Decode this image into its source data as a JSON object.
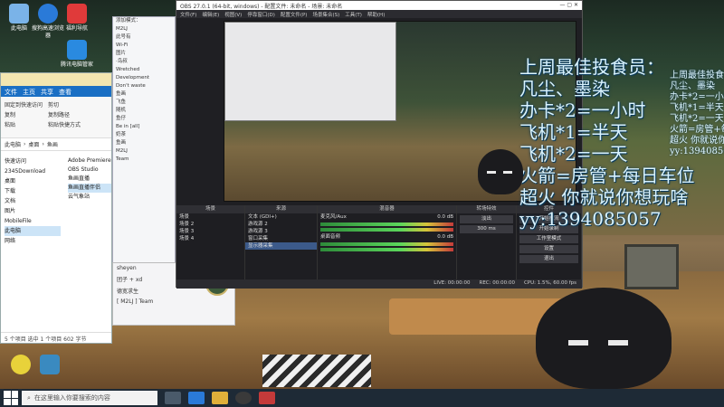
{
  "explorer": {
    "title": "",
    "tabs": [
      "文件",
      "主页",
      "共享",
      "查看",
      "管理",
      "应用程序工具"
    ],
    "ribbon": [
      "固定到快速访问",
      "复制",
      "粘贴",
      "剪切",
      "复制路径",
      "粘贴快捷方式"
    ],
    "address": [
      "此电脑",
      "桌面",
      "鱼画"
    ],
    "nav_items": [
      "快速访问",
      "2345Download",
      "桌面",
      "下载",
      "文档",
      "图片",
      "MobileFile",
      "此电脑",
      "网络"
    ],
    "files": [
      "Adobe Premiere",
      "OBS Studio",
      "鱼画直播",
      "鱼画直播伴侣",
      "云气象站"
    ],
    "status": "5 个项目    选中 1 个项目  602 字节"
  },
  "chat": {
    "rows": [
      "添加模式：",
      "M2LJ",
      "此号有",
      "Wi-Fi",
      "图片",
      "·鸟叔",
      "Wretched",
      "Development",
      "Don't waste",
      "鱼画",
      "飞鱼",
      "随机",
      "鱼仔",
      "Be in [all]",
      "奶茶",
      "鱼画",
      "M2LJ",
      "Team"
    ],
    "bottom_rows": [
      "sheyen",
      "团子 + xd",
      "德宽求生",
      "[ M2LJ ] Team"
    ]
  },
  "obs": {
    "title": "OBS 27.0.1 (64-bit, windows) - 配置文件: 未命名 - 场景: 未命名",
    "menu": [
      "文件(F)",
      "编辑(E)",
      "视图(V)",
      "停靠窗口(D)",
      "配置文件(P)",
      "场景集合(S)",
      "工具(T)",
      "帮助(H)"
    ],
    "panel_headers": [
      "场景",
      "来源",
      "混音器",
      "转场特效",
      "控件"
    ],
    "scenes": [
      "场景",
      "场景 2",
      "场景 3",
      "场景 4"
    ],
    "sources": [
      "文本 (GDI+)",
      "游戏源 2",
      "游戏源 3",
      "窗口采集",
      "显示器采集"
    ],
    "mixer": [
      {
        "name": "麦克风/Aux",
        "db": "0.0 dB"
      },
      {
        "name": "桌面音频",
        "db": "0.0 dB"
      }
    ],
    "transition": "淡出",
    "duration": "300 ms",
    "controls": [
      "开始推流",
      "开始录制",
      "工作室模式",
      "设置",
      "退出"
    ],
    "status": [
      "LIVE: 00:00:00",
      "REC: 00:00:00",
      "CPU: 1.5%, 60.00 fps"
    ]
  },
  "overlay": {
    "small_lines": [
      "上周最佳投食员：",
      "凡尘、墨染",
      "办卡*2=一小时",
      "飞机*1=半天",
      "飞机*2=一天",
      "火箭=房管+每日车位",
      "超火 你就说你想玩啥",
      "yy:1394085057"
    ],
    "lines": [
      "上周最佳投食员：",
      "凡尘、墨染",
      "办卡*2=一小时",
      "飞机*1=半天",
      "飞机*2=一天",
      "火箭=房管+每日车位",
      "超火 你就说你想玩啥",
      "yy:1394085057"
    ]
  },
  "desktop_icons": [
    "此电脑",
    "搜狗高速浏览器",
    "福利导航",
    "腾讯电脑管家",
    "回收站"
  ],
  "taskbar": {
    "search_placeholder": "在这里输入你要搜索的内容"
  },
  "colors": {
    "accent": "#1a6fc4",
    "overlay_text": "#d9f3ff",
    "taskbar": "#1e2a36"
  }
}
